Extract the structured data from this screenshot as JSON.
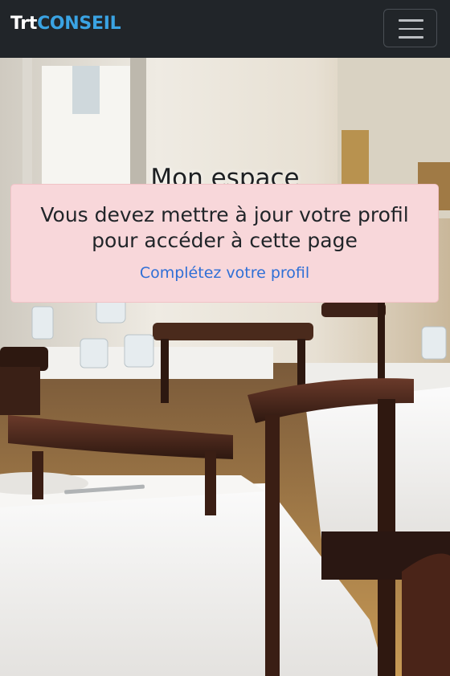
{
  "navbar": {
    "brand_part1": "Trt",
    "brand_part2": "CONSEIL",
    "toggle_icon": "hamburger-menu-icon",
    "colors": {
      "background": "#212529",
      "brand_accent": "#3aa3e3"
    }
  },
  "page": {
    "title": "Mon espace"
  },
  "alert": {
    "message": "Vous devez mettre à jour votre profil pour accéder à cette page",
    "link_label": "Complétez votre profil",
    "colors": {
      "background": "#f8d7da",
      "link": "#2f6fd6"
    }
  }
}
